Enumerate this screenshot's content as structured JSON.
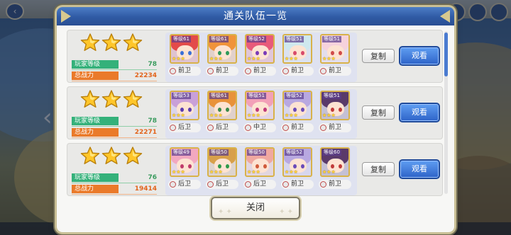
{
  "modal": {
    "title": "通关队伍一览",
    "close_label": "关闭"
  },
  "labels": {
    "player_level": "玩家等级",
    "total_power": "总战力",
    "copy": "复制",
    "view": "观看"
  },
  "teams": [
    {
      "stars": 3,
      "player_level": "78",
      "total_power": "22234",
      "characters": [
        {
          "level": "等级61",
          "role": "前卫",
          "hair": "#e34a4a",
          "eyes": "#3a6fd8"
        },
        {
          "level": "等级61",
          "role": "前卫",
          "hair": "#f0933a",
          "eyes": "#2e9a5a"
        },
        {
          "level": "等级52",
          "role": "前卫",
          "hair": "#e85a7a",
          "eyes": "#7a3ab8"
        },
        {
          "level": "等级51",
          "role": "前卫",
          "hair": "#cfe8ee",
          "eyes": "#d84a6a"
        },
        {
          "level": "等级51",
          "role": "前卫",
          "hair": "#f6d2dc",
          "eyes": "#d04a4a"
        }
      ]
    },
    {
      "stars": 3,
      "player_level": "78",
      "total_power": "22271",
      "characters": [
        {
          "level": "等级53",
          "role": "后卫",
          "hair": "#c9a0d8",
          "eyes": "#5a3ab0"
        },
        {
          "level": "等级61",
          "role": "后卫",
          "hair": "#e8923a",
          "eyes": "#3a8a4a"
        },
        {
          "level": "等级51",
          "role": "中卫",
          "hair": "#f2a0b8",
          "eyes": "#c03a7a"
        },
        {
          "level": "等级52",
          "role": "前卫",
          "hair": "#b8a8e0",
          "eyes": "#6a4ab8"
        },
        {
          "level": "等级51",
          "role": "前卫",
          "hair": "#5a3a6a",
          "eyes": "#c03a3a"
        }
      ]
    },
    {
      "stars": 3,
      "player_level": "76",
      "total_power": "19414",
      "characters": [
        {
          "level": "等级49",
          "role": "后卫",
          "hair": "#f2a8c0",
          "eyes": "#c03a6a"
        },
        {
          "level": "等级50",
          "role": "后卫",
          "hair": "#d8a04a",
          "eyes": "#2e9a4a"
        },
        {
          "level": "等级50",
          "role": "后卫",
          "hair": "#f0a8a0",
          "eyes": "#d05a3a"
        },
        {
          "level": "等级52",
          "role": "前卫",
          "hair": "#b8a8e0",
          "eyes": "#6a4ab8"
        },
        {
          "level": "等级60",
          "role": "前卫",
          "hair": "#5a3a6a",
          "eyes": "#c03a3a"
        }
      ]
    }
  ],
  "colors": {
    "title_bar": "#2f5aa4",
    "view_button": "#2e63c8",
    "level_tag": "#34b17a",
    "power_tag": "#ea7a2a",
    "star": "#ffc62a"
  }
}
